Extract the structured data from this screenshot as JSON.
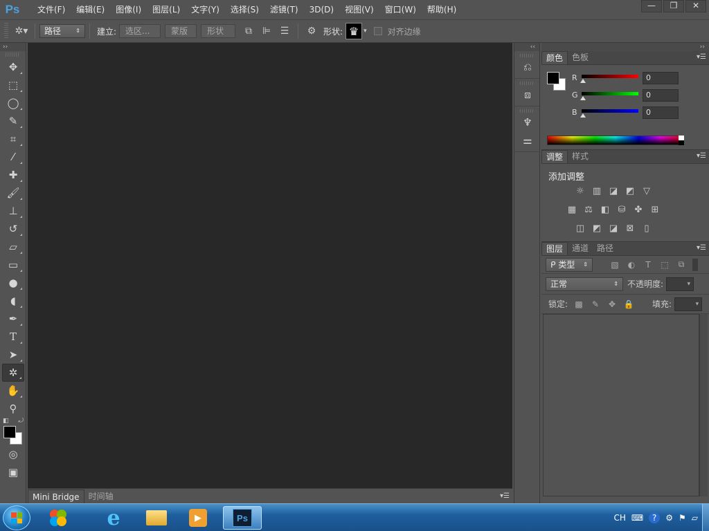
{
  "app": {
    "logo": "Ps",
    "menus": [
      "文件(F)",
      "编辑(E)",
      "图像(I)",
      "图层(L)",
      "文字(Y)",
      "选择(S)",
      "滤镜(T)",
      "3D(D)",
      "视图(V)",
      "窗口(W)",
      "帮助(H)"
    ],
    "window_controls": {
      "minimize": "—",
      "restore": "❐",
      "close": "✕"
    }
  },
  "options": {
    "mode_select": "路径",
    "make_label": "建立:",
    "selection_btn": "选区...",
    "mask_btn": "蒙版",
    "shape_btn": "形状",
    "shape_label": "形状:",
    "align_edges": "对齐边缘",
    "shape_glyph": "♛"
  },
  "bottom_tabs": [
    "Mini Bridge",
    "时间轴"
  ],
  "color_panel": {
    "tabs": [
      "颜色",
      "色板"
    ],
    "r_label": "R",
    "g_label": "G",
    "b_label": "B",
    "r_value": "0",
    "g_value": "0",
    "b_value": "0"
  },
  "adjust_panel": {
    "tabs": [
      "调整",
      "样式"
    ],
    "title": "添加调整"
  },
  "layers_panel": {
    "tabs": [
      "图层",
      "通道",
      "路径"
    ],
    "filter_select": "ᑭ 类型",
    "blend_select": "正常",
    "opacity_label": "不透明度:",
    "lock_label": "锁定:",
    "fill_label": "填充:"
  },
  "taskbar": {
    "ps_label": "Ps",
    "lang": "CH"
  }
}
